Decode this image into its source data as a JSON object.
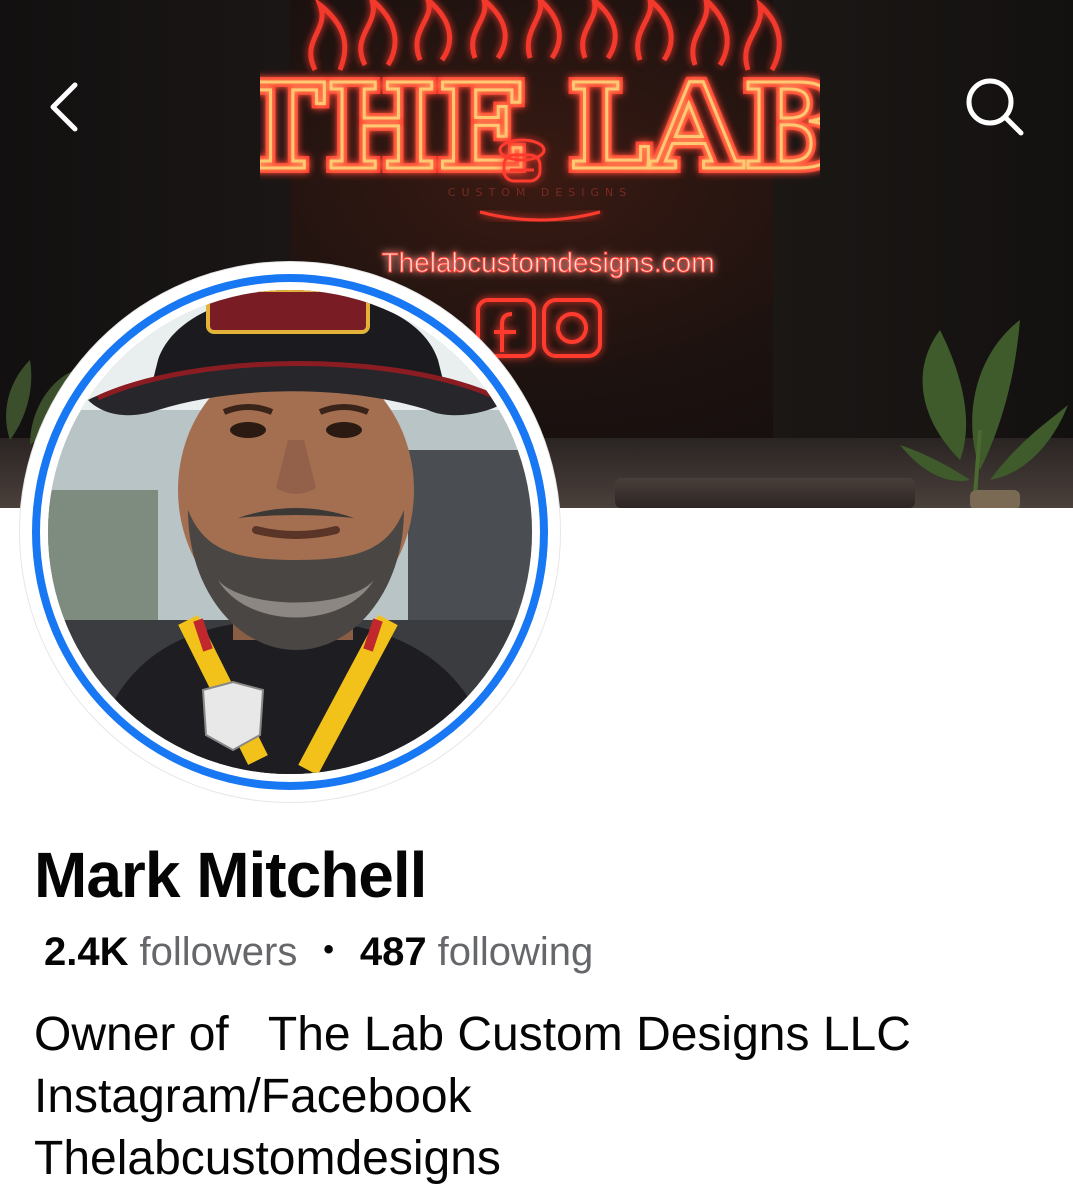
{
  "header": {
    "back_icon": "chevron-left-icon",
    "search_icon": "search-icon"
  },
  "cover": {
    "sign_title": "THE LAB",
    "sign_url": "Thelabcustomdesigns.com"
  },
  "profile": {
    "name": "Mark Mitchell",
    "followers_count": "2.4K",
    "followers_label": "followers",
    "separator": "•",
    "following_count": "487",
    "following_label": "following",
    "bio_lines": [
      "Owner of   The Lab Custom Designs LLC",
      "Instagram/Facebook",
      "Thelabcustomdesigns"
    ]
  },
  "colors": {
    "accent": "#1877f2",
    "text_primary": "#050505",
    "text_secondary": "#65676b",
    "neon_red": "#ff3b2f",
    "neon_orange": "#ffb347"
  }
}
